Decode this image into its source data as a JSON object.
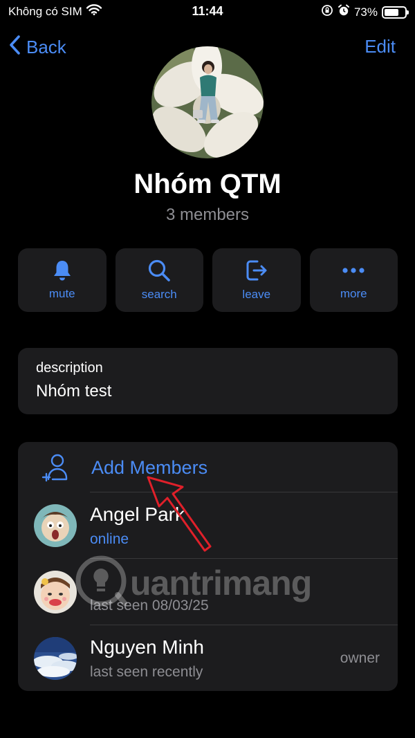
{
  "status_bar": {
    "carrier": "Không có SIM",
    "time": "11:44",
    "battery_percent": "73%",
    "battery_level": 0.73,
    "icons": [
      "wifi-icon",
      "orientation-lock-icon",
      "alarm-icon",
      "battery-icon"
    ]
  },
  "nav": {
    "back_label": "Back",
    "edit_label": "Edit"
  },
  "group": {
    "title": "Nhóm QTM",
    "subtitle": "3 members"
  },
  "actions": [
    {
      "label": "mute",
      "icon": "bell-icon"
    },
    {
      "label": "search",
      "icon": "search-icon"
    },
    {
      "label": "leave",
      "icon": "leave-icon"
    },
    {
      "label": "more",
      "icon": "more-icon"
    }
  ],
  "description": {
    "label": "description",
    "value": "Nhóm test"
  },
  "members": {
    "add_label": "Add Members",
    "items": [
      {
        "name": "Angel Park",
        "status": "online",
        "role": ""
      },
      {
        "name": "",
        "status": "last seen 08/03/25",
        "role": ""
      },
      {
        "name": "Nguyen Minh",
        "status": "last seen recently",
        "role": "owner"
      }
    ]
  },
  "watermark": {
    "text": "uantrimang"
  },
  "colors": {
    "accent": "#4b8cf5",
    "background": "#000000",
    "card": "#1c1c1e",
    "secondary_text": "#8e8e93",
    "annotation_arrow": "#e0202a"
  }
}
